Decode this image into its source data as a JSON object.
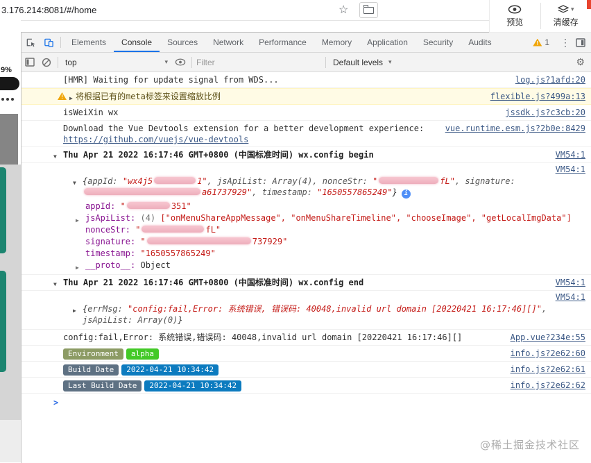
{
  "browser": {
    "url": "3.176.214:8081/#/home",
    "actions": {
      "preview_label": "预览",
      "clear_cache_label": "清缓存"
    }
  },
  "page": {
    "battery_percent": "9%"
  },
  "devtools": {
    "tabs": [
      "Elements",
      "Console",
      "Sources",
      "Network",
      "Performance",
      "Memory",
      "Application",
      "Security",
      "Audits"
    ],
    "selected_tab": "Console",
    "warning_count": "1",
    "toolbar": {
      "context": "top",
      "filter_placeholder": "Filter",
      "levels_label": "Default levels"
    }
  },
  "icons": {
    "star": "☆",
    "caret": "▾",
    "kebab": "⋮",
    "gear": "⚙",
    "exclaim": "!",
    "arrow_open": "▼",
    "arrow_closed": "▶",
    "info": "i"
  },
  "console": {
    "prompt": ">",
    "rows": {
      "hmr": {
        "text": "[HMR] Waiting for update signal from WDS...",
        "source": "log.js?1afd:20"
      },
      "meta_warning": {
        "text": "将根据已有的meta标签来设置缩放比例",
        "source": "flexible.js?499a:13"
      },
      "isweixin": {
        "text": "isWeiXin wx",
        "source": "jssdk.js?c3cb:20"
      },
      "vue_devtools": {
        "text": "Download the Vue Devtools extension for a better development experience:",
        "link": "https://github.com/vuejs/vue-devtools",
        "source": "vue.runtime.esm.js?2b0e:8429"
      },
      "group_begin": {
        "text": "Thu Apr 21 2022 16:17:46 GMT+0800 (中国标准时间) wx.config begin",
        "source": "VM54:1"
      },
      "config_obj": {
        "source": "VM54:1",
        "preview": {
          "open": "{",
          "k_appid": "appId: ",
          "v_appid_pre": "\"wx4j5",
          "v_appid_post": "1\"",
          "k_jsapilist": ", jsApiList: ",
          "v_jsapilist": "Array(4)",
          "k_noncestr": ", nonceStr: ",
          "v_noncestr_pre": "\"",
          "v_noncestr_post": "fL\"",
          "k_signature": ", signature: ",
          "v_signature_post": "a61737929\"",
          "k_timestamp": ", timestamp: ",
          "v_timestamp": "\"1650557865249\"",
          "close": "}"
        },
        "props": {
          "appid_key": "appId: ",
          "appid_pre": "\"",
          "appid_post": "351\"",
          "jsapilist_key": "jsApiList: ",
          "jsapilist_count": "(4) ",
          "jsapilist_items": "[\"onMenuShareAppMessage\", \"onMenuShareTimeline\", \"chooseImage\", \"getLocalImgData\"]",
          "noncestr_key": "nonceStr: ",
          "noncestr_pre": "\"",
          "noncestr_post": "fL\"",
          "signature_key": "signature: ",
          "signature_pre": "\"",
          "signature_post": "737929\"",
          "timestamp_key": "timestamp: ",
          "timestamp_val": "\"1650557865249\"",
          "proto_key": "__proto__: ",
          "proto_val": "Object"
        }
      },
      "group_end": {
        "text": "Thu Apr 21 2022 16:17:46 GMT+0800 (中国标准时间) wx.config end",
        "source": "VM54:1"
      },
      "err_obj": {
        "source": "VM54:1",
        "open": "{",
        "k_errmsg": "errMsg: ",
        "v_errmsg": "\"config:fail,Error: 系统错误, 错误码: 40048,invalid url domain [20220421 16:17:46][]\"",
        "k_jsapilist": ", jsApiList: ",
        "v_jsapilist": "Array(0)",
        "close": "}"
      },
      "config_fail": {
        "text": "config:fail,Error: 系统错误,错误码: 40048,invalid url domain [20220421 16:17:46][]",
        "source": "App.vue?234e:55"
      },
      "env": {
        "label": "Environment",
        "value": "alpha",
        "source": "info.js?2e62:60"
      },
      "build": {
        "label": "Build Date",
        "value": "2022-04-21 10:34:42",
        "source": "info.js?2e62:61"
      },
      "last_build": {
        "label": "Last Build Date",
        "value": "2022-04-21 10:34:42",
        "source": "info.js?2e62:62"
      }
    }
  },
  "colors": {
    "accent_blue": "#1a73e8",
    "link_blue": "#3b5885",
    "property_purple": "#881391",
    "string_red": "#c41a16",
    "warning_bg": "#fffbe5",
    "env_badge": "#8c9b64",
    "alpha_badge": "#43c927",
    "build_label_badge": "#5e7183",
    "build_value_badge": "#0c7bbf",
    "teal_card": "#1c8570",
    "redaction_pink": "#f3b7c3"
  },
  "watermark": "@稀土掘金技术社区"
}
